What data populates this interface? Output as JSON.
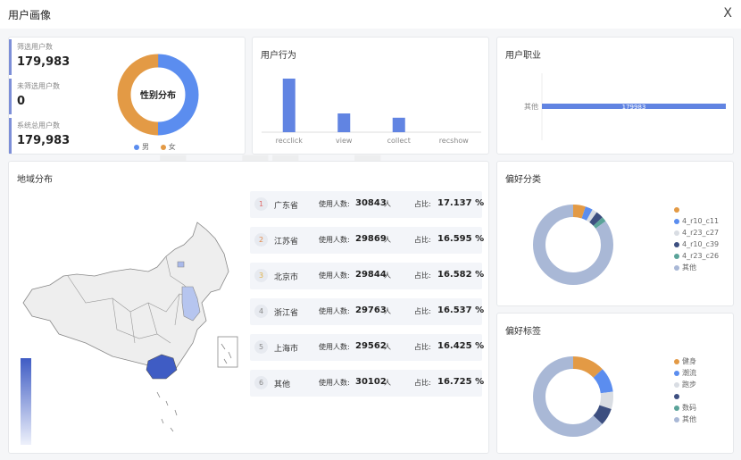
{
  "header": {
    "title": "用户画像",
    "close_label": "X"
  },
  "stats": {
    "filtered_label": "筛选用户数",
    "filtered_value": "179,983",
    "unfiltered_label": "未筛选用户数",
    "unfiltered_value": "0",
    "total_label": "系统总用户数",
    "total_value": "179,983"
  },
  "gender": {
    "title": "性别分布",
    "legend": [
      {
        "name": "男",
        "color": "#5b8def"
      },
      {
        "name": "女",
        "color": "#e39a45"
      }
    ],
    "values": [
      50,
      50
    ]
  },
  "behavior": {
    "title": "用户行为"
  },
  "occupation": {
    "title": "用户职业",
    "bar_value_label": "179983"
  },
  "region": {
    "title": "地域分布",
    "user_label": "使用人数:",
    "person_unit": "人",
    "ratio_label": "占比:",
    "rows": [
      {
        "idx": "1",
        "name": "广东省",
        "users": "30843",
        "ratio": "17.137 %"
      },
      {
        "idx": "2",
        "name": "江苏省",
        "users": "29869",
        "ratio": "16.595 %"
      },
      {
        "idx": "3",
        "name": "北京市",
        "users": "29844",
        "ratio": "16.582 %"
      },
      {
        "idx": "4",
        "name": "浙江省",
        "users": "29763",
        "ratio": "16.537 %"
      },
      {
        "idx": "5",
        "name": "上海市",
        "users": "29562",
        "ratio": "16.425 %"
      },
      {
        "idx": "6",
        "name": "其他",
        "users": "30102",
        "ratio": "16.725 %"
      }
    ],
    "colors": {
      "highlight": "#3f5cc4",
      "mid": "#a9b9ea",
      "base": "#eeeeee"
    }
  },
  "pref_category": {
    "title": "偏好分类",
    "legend": [
      {
        "name": "",
        "color": "#e39a45"
      },
      {
        "name": "4_r10_c11",
        "color": "#5b8def"
      },
      {
        "name": "4_r23_c27",
        "color": "#d9dde3"
      },
      {
        "name": "4_r10_c39",
        "color": "#3d4f80"
      },
      {
        "name": "4_r23_c26",
        "color": "#5aa399"
      },
      {
        "name": "其他",
        "color": "#a9b8d6"
      }
    ],
    "values": [
      5,
      3,
      2,
      3,
      2,
      85
    ]
  },
  "pref_tag": {
    "title": "偏好标签",
    "legend": [
      {
        "name": "健身",
        "color": "#e39a45"
      },
      {
        "name": "潮流",
        "color": "#5b8def"
      },
      {
        "name": "跑步",
        "color": "#d9dde3"
      },
      {
        "name": "",
        "color": "#3d4f80"
      },
      {
        "name": "数码",
        "color": "#5aa399"
      },
      {
        "name": "其他",
        "color": "#a9b8d6"
      }
    ],
    "values": [
      13,
      10,
      7,
      7,
      0,
      63
    ]
  },
  "chart_data": [
    {
      "type": "bar",
      "title": "用户行为",
      "categories": [
        "recclick",
        "view",
        "collect",
        "recshow"
      ],
      "values": [
        100,
        35,
        27,
        0
      ],
      "color": "#6184e2"
    },
    {
      "type": "bar",
      "orientation": "horizontal",
      "title": "用户职业",
      "categories": [
        "其他"
      ],
      "values": [
        179983
      ],
      "color": "#6184e2"
    }
  ]
}
